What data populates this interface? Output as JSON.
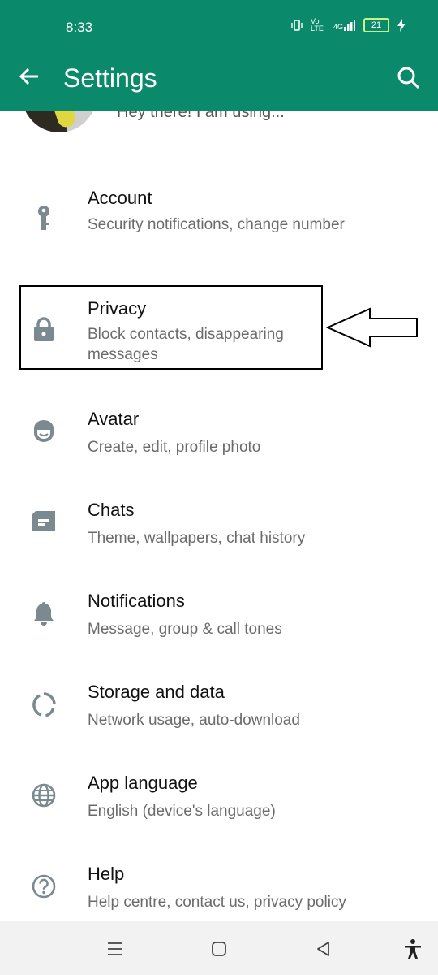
{
  "status_bar": {
    "time": "8:33",
    "network": "4G",
    "volte": "Vo LTE",
    "battery": "21"
  },
  "header": {
    "title": "Settings"
  },
  "profile": {
    "about": "Hey there! I am using..."
  },
  "items": [
    {
      "label": "Account",
      "sub": "Security notifications, change number",
      "icon": "key-icon"
    },
    {
      "label": "Privacy",
      "sub": "Block contacts, disappearing messages",
      "icon": "lock-icon"
    },
    {
      "label": "Avatar",
      "sub": "Create, edit, profile photo",
      "icon": "avatar-face-icon"
    },
    {
      "label": "Chats",
      "sub": "Theme, wallpapers, chat history",
      "icon": "chat-icon"
    },
    {
      "label": "Notifications",
      "sub": "Message, group & call tones",
      "icon": "bell-icon"
    },
    {
      "label": "Storage and data",
      "sub": "Network usage, auto-download",
      "icon": "storage-circle-icon"
    },
    {
      "label": "App language",
      "sub": "English (device's language)",
      "icon": "globe-icon"
    },
    {
      "label": "Help",
      "sub": "Help centre, contact us, privacy policy",
      "icon": "help-icon"
    }
  ],
  "colors": {
    "appbar": "#0b8a6b",
    "icon": "#7b8a90",
    "label": "#111111",
    "sub": "#6b6b6b"
  }
}
